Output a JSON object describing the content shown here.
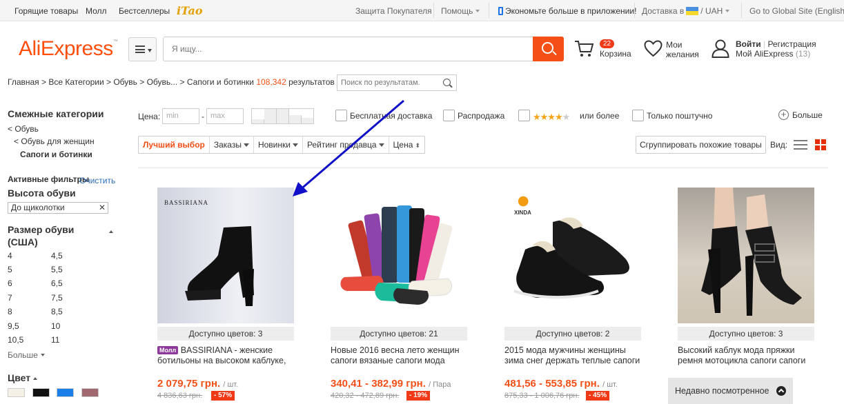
{
  "topbar": {
    "left_links": [
      "Горящие товары",
      "Молл",
      "Бестселлеры"
    ],
    "itao": "iTao",
    "buyer_protection": "Защита Покупателя",
    "help": "Помощь",
    "app": "Экономьте больше в приложении!",
    "delivery": "Доставка в",
    "currency_sep": "/",
    "currency": "UAH",
    "global": "Go to Global Site (English)"
  },
  "header": {
    "logo": "AliExpress",
    "search_placeholder": "Я ищу...",
    "cart_count": "22",
    "cart_label": "Корзина",
    "wishlist_line1": "Мои",
    "wishlist_line2": "желания",
    "signin": "Войти",
    "register": "Регистрация",
    "my_ali": "Мой AliExpress",
    "my_ali_count": "(13)"
  },
  "breadcrumb": {
    "path": "Главная > Все Категории > Обувь > Обувь... > ",
    "current": "Сапоги и ботинки",
    "count": "108,342",
    "results": "результатов >",
    "search_placeholder": "Поиск по результатам."
  },
  "sidebar": {
    "related_title": "Смежные категории",
    "cat1": "< Обувь",
    "cat2": "< Обувь для женщин",
    "cat3": "Сапоги и ботинки",
    "active_filters": "Активные фильтры",
    "clear": "Очистить",
    "heel_title": "Высота обуви",
    "heel_value": "До щиколотки",
    "size_title_1": "Размер обуви",
    "size_title_2": "(США)",
    "sizes_left": [
      "4",
      "5",
      "6",
      "7",
      "8",
      "9,5",
      "10,5"
    ],
    "sizes_right": [
      "4,5",
      "5,5",
      "6,5",
      "7,5",
      "8,5",
      "10",
      "11"
    ],
    "more": "Больше",
    "color_title": "Цвет",
    "colors": [
      "#f4f0e6",
      "#111111",
      "#1a7fe8",
      "#a0686f"
    ]
  },
  "filters": {
    "price_label": "Цена:",
    "min": "min",
    "dash": "-",
    "max": "max",
    "free_shipping": "Бесплатная доставка",
    "sale": "Распродажа",
    "rating_suffix": "или более",
    "single": "Только поштучно",
    "more": "Больше"
  },
  "sort": {
    "best": "Лучший выбор",
    "orders": "Заказы",
    "new": "Новинки",
    "seller": "Рейтинг продавца",
    "price": "Цена",
    "group": "Сгруппировать похожие товары",
    "view": "Вид:"
  },
  "products": [
    {
      "colors": "Доступно цветов: 3",
      "mall": "Молл",
      "title_1": "BASSIRIANA - женские",
      "title_2": "ботильоны на высоком каблуке,",
      "price": "2 079,75 грн.",
      "unit": "/ шт.",
      "old": "4 836,63 грн.",
      "disc": "- 57%",
      "brand": "BASSIRIANA"
    },
    {
      "colors": "Доступно цветов: 21",
      "title_1": "Новые 2016 весна лето женщин",
      "title_2": "сапоги вязаные сапоги мода",
      "price": "340,41 - 382,99 грн.",
      "unit": "/ Пара",
      "old": "420,32 - 472,89 грн.",
      "disc": "- 19%"
    },
    {
      "colors": "Доступно цветов: 2",
      "title_1": "2015 мода мужчины женщины",
      "title_2": "зима снег держать теплые сапоги",
      "price": "481,56 - 553,85 грн.",
      "unit": "/ шт.",
      "old": "875,33 - 1 006,76 грн.",
      "disc": "- 45%",
      "brand": "XINDA"
    },
    {
      "colors": "Доступно цветов: 3",
      "title_1": "Высокий каблук мода пряжки",
      "title_2": "ремня мотоцикла сапоги сапоги"
    }
  ],
  "recent": "Недавно посмотренное"
}
